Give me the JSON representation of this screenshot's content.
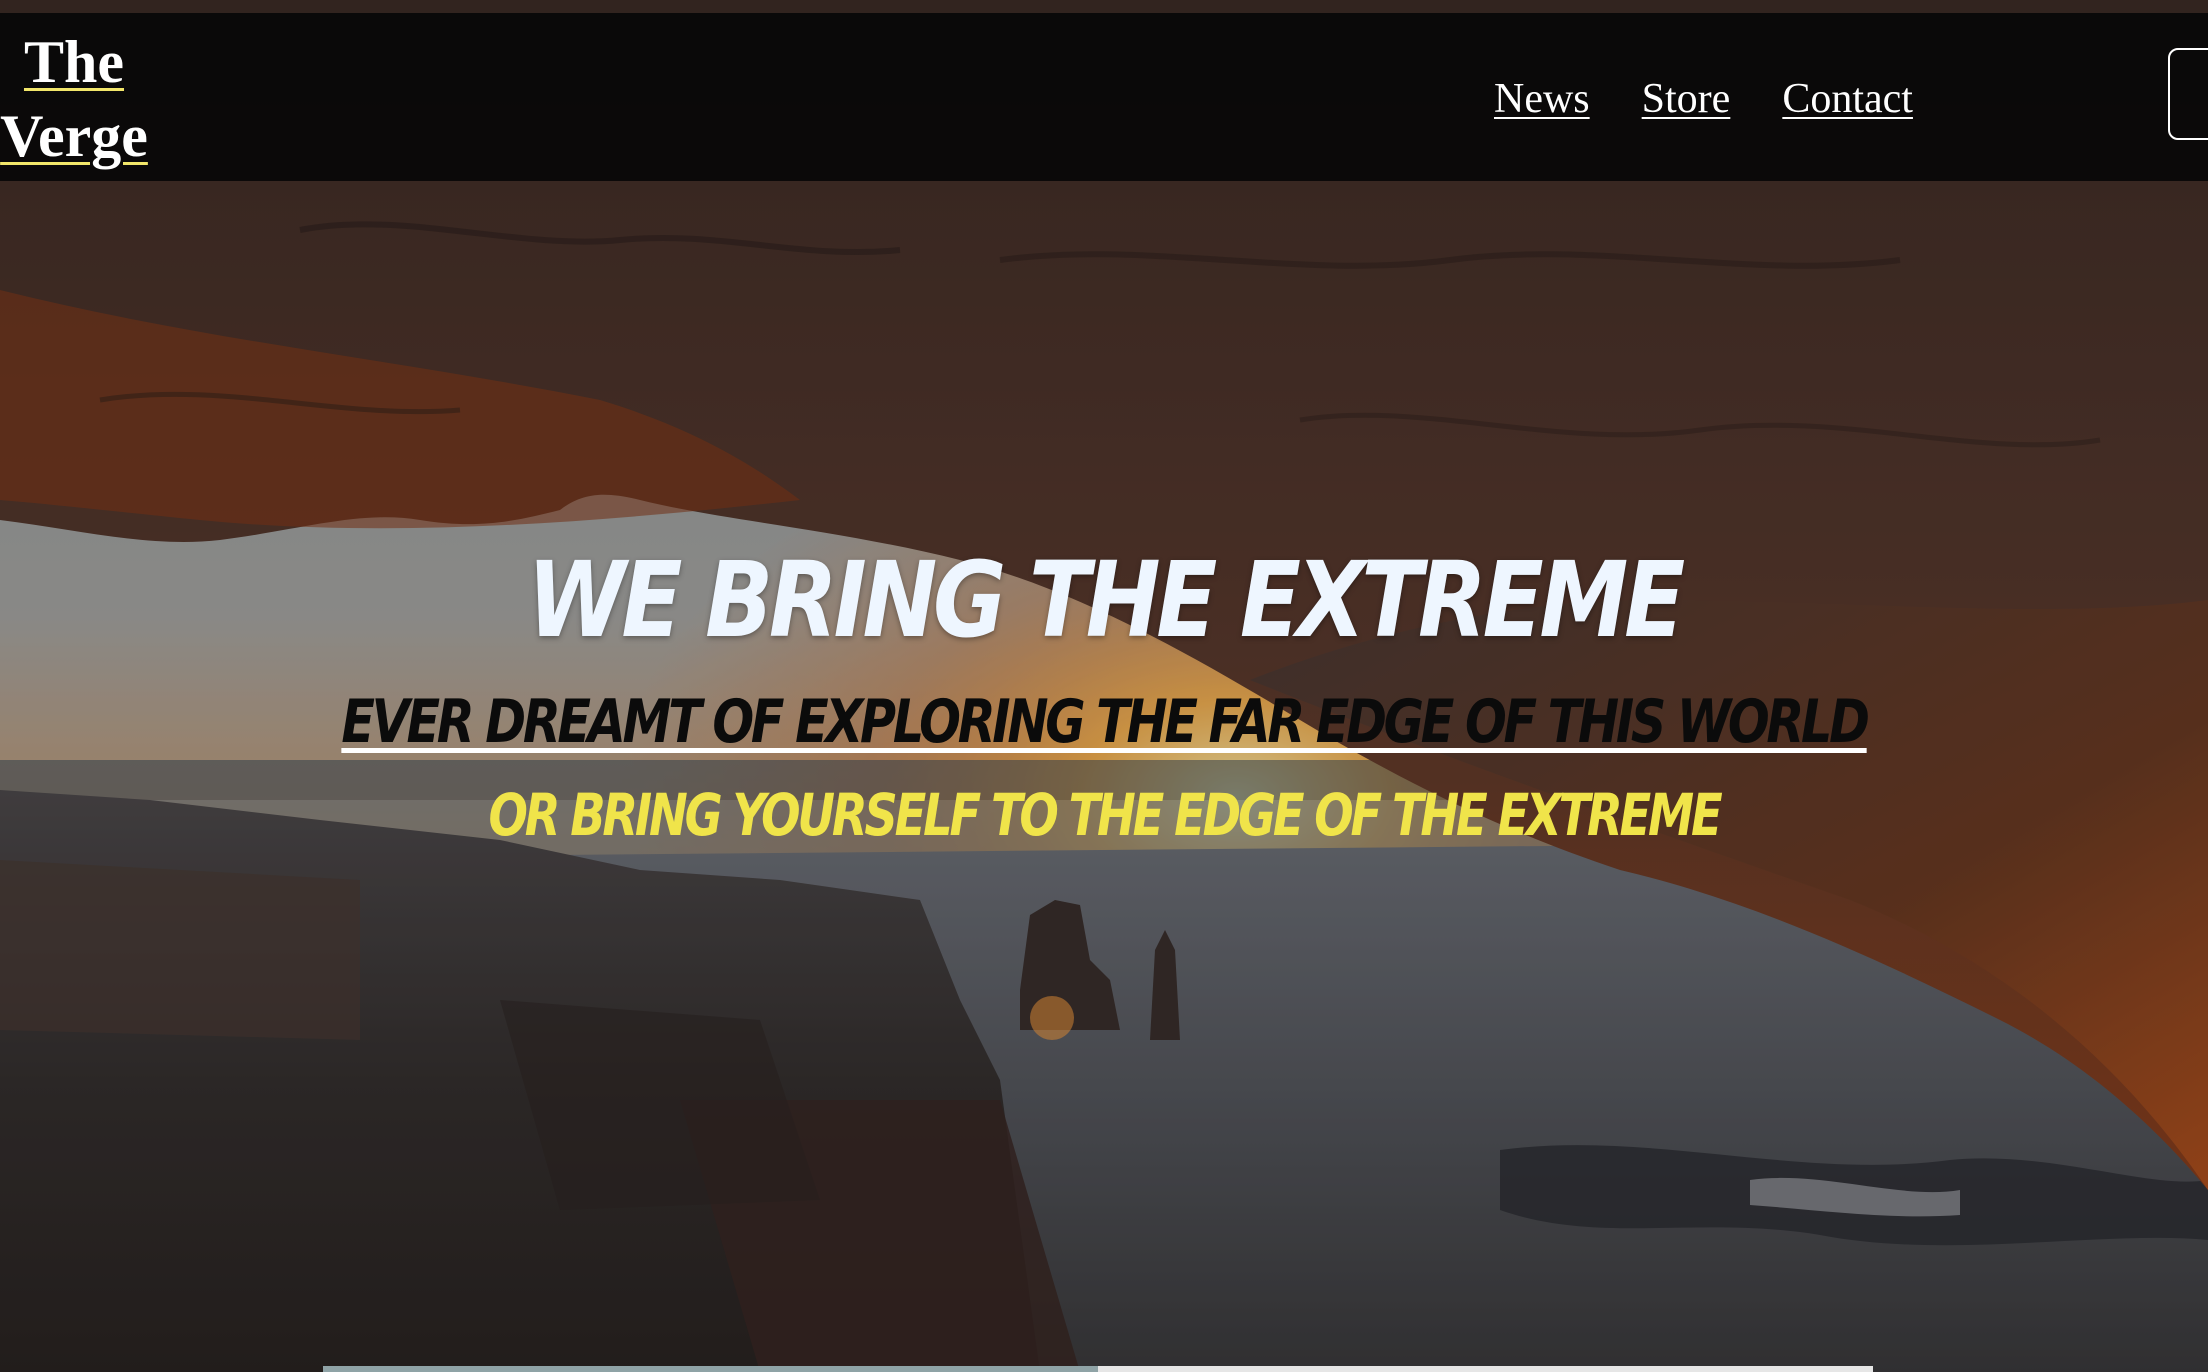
{
  "header": {
    "logo_line1": "The",
    "logo_line2": "Verge",
    "nav": [
      {
        "label": "News"
      },
      {
        "label": "Store"
      },
      {
        "label": "Contact"
      }
    ]
  },
  "hero": {
    "title": "We Bring The Extreme",
    "subtitle": "Ever dreamt of exploring the far edge of this world",
    "tagline": "or bring yourself to the edge of the extreme"
  },
  "colors": {
    "header_bg": "#080808",
    "title_text": "#eef6ff",
    "subtitle_text": "#0b0b0b",
    "tagline_text": "#f0e44a",
    "logo_underline": "#f2e66a"
  }
}
